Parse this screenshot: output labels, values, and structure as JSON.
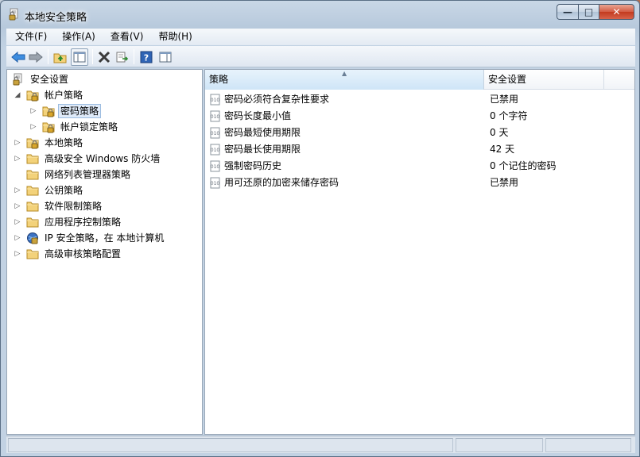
{
  "window": {
    "title": "本地安全策略",
    "controls": {
      "minimize": "—",
      "maximize": "□",
      "close": "✕"
    }
  },
  "menu": [
    {
      "label": "文件(F)"
    },
    {
      "label": "操作(A)"
    },
    {
      "label": "查看(V)"
    },
    {
      "label": "帮助(H)"
    }
  ],
  "toolbar": {
    "icons": [
      "back-icon",
      "forward-icon",
      "up-folder-icon",
      "show-hide-tree-icon",
      "delete-icon",
      "export-list-icon",
      "help-icon",
      "properties-pane-icon"
    ]
  },
  "tree": [
    {
      "label": "安全设置",
      "icon": "security-settings-icon",
      "expander": ""
    },
    {
      "label": "帐户策略",
      "icon": "folder-lock-icon",
      "expander": "◢"
    },
    {
      "label": "密码策略",
      "icon": "folder-lock-icon",
      "expander": "▷",
      "selected": true
    },
    {
      "label": "帐户锁定策略",
      "icon": "folder-lock-icon",
      "expander": "▷"
    },
    {
      "label": "本地策略",
      "icon": "folder-lock-icon",
      "expander": "▷"
    },
    {
      "label": "高级安全 Windows 防火墙",
      "icon": "folder-icon",
      "expander": "▷"
    },
    {
      "label": "网络列表管理器策略",
      "icon": "folder-icon",
      "expander": ""
    },
    {
      "label": "公钥策略",
      "icon": "folder-icon",
      "expander": "▷"
    },
    {
      "label": "软件限制策略",
      "icon": "folder-icon",
      "expander": "▷"
    },
    {
      "label": "应用程序控制策略",
      "icon": "folder-icon",
      "expander": "▷"
    },
    {
      "label": "IP 安全策略，在 本地计算机",
      "icon": "ip-security-icon",
      "expander": "▷"
    },
    {
      "label": "高级审核策略配置",
      "icon": "folder-icon",
      "expander": "▷"
    }
  ],
  "list": {
    "columns": {
      "policy": "策略",
      "setting": "安全设置"
    },
    "rows": [
      {
        "name": "密码必须符合复杂性要求",
        "value": "已禁用"
      },
      {
        "name": "密码长度最小值",
        "value": "0 个字符"
      },
      {
        "name": "密码最短使用期限",
        "value": "0 天"
      },
      {
        "name": "密码最长使用期限",
        "value": "42 天"
      },
      {
        "name": "强制密码历史",
        "value": "0 个记住的密码"
      },
      {
        "name": "用可还原的加密来储存密码",
        "value": "已禁用"
      }
    ]
  },
  "colors": {
    "selection": "#dfeaf8",
    "header_sorted": "#cfe5f7",
    "folder": "#f3d27a"
  }
}
